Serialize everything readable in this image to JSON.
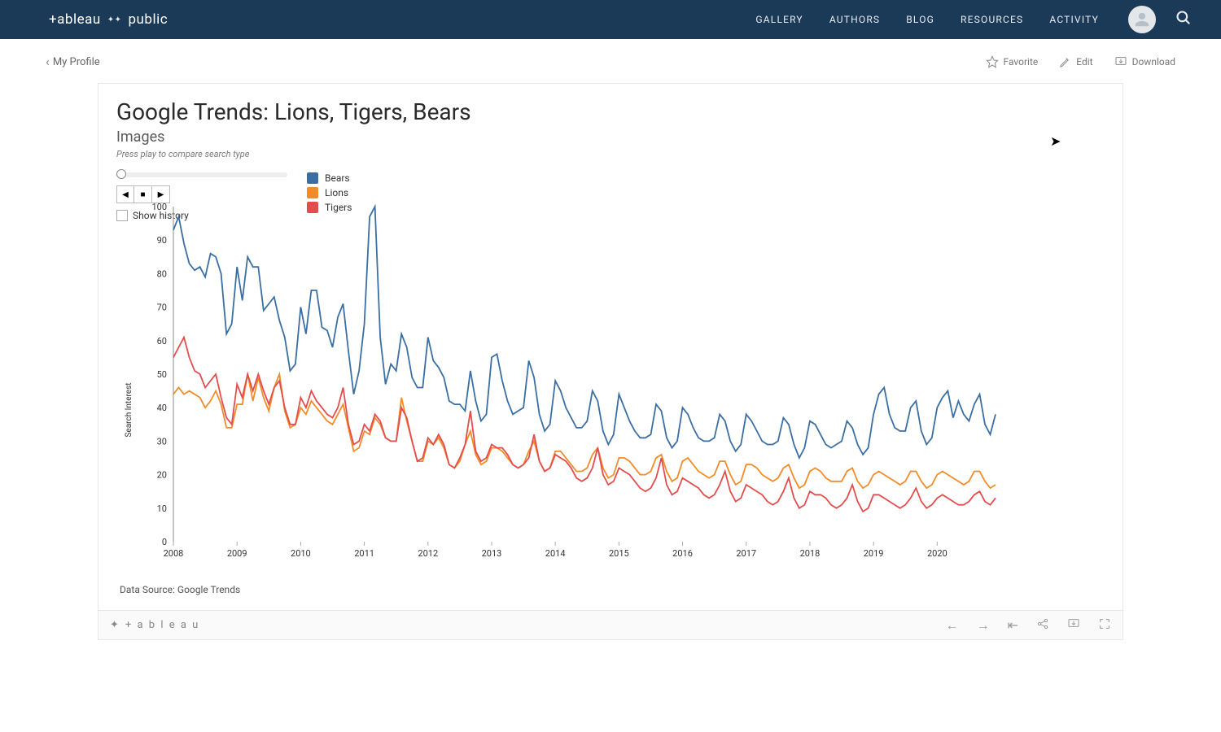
{
  "nav": {
    "brand_left": "+ableau",
    "brand_plus": "✦✦",
    "brand_right": "public",
    "links": [
      "GALLERY",
      "AUTHORS",
      "BLOG",
      "RESOURCES",
      "ACTIVITY"
    ]
  },
  "subbar": {
    "back": "My Profile",
    "favorite": "Favorite",
    "edit": "Edit",
    "download": "Download"
  },
  "viz": {
    "title": "Google Trends: Lions, Tigers, Bears",
    "subtitle": "Images",
    "hint": "Press play to compare search type",
    "show_history": "Show history",
    "data_source": "Data Source: Google Trends"
  },
  "legend": [
    {
      "name": "Bears",
      "color": "#3b6fa3"
    },
    {
      "name": "Lions",
      "color": "#f28c28"
    },
    {
      "name": "Tigers",
      "color": "#e34d4d"
    }
  ],
  "footer": {
    "brand": "+ a b l e a u"
  },
  "chart_data": {
    "type": "line",
    "title": "Google Trends: Lions, Tigers, Bears — Images",
    "xlabel": "",
    "ylabel": "Search Interest",
    "ylim": [
      0,
      100
    ],
    "x_ticks": [
      "2008",
      "2009",
      "2010",
      "2011",
      "2012",
      "2013",
      "2014",
      "2015",
      "2016",
      "2017",
      "2018",
      "2019",
      "2020"
    ],
    "x_step_months": 1,
    "x_start_year": 2008,
    "legend_position": "top-left-inside",
    "series": [
      {
        "name": "Bears",
        "color": "#3b6fa3",
        "values": [
          93,
          97,
          89,
          83,
          81,
          82,
          79,
          86,
          85,
          80,
          62,
          65,
          82,
          72,
          85,
          82,
          82,
          69,
          71,
          73,
          66,
          61,
          51,
          53,
          70,
          62,
          75,
          75,
          64,
          63,
          58,
          67,
          71,
          57,
          44,
          51,
          65,
          97,
          100,
          61,
          47,
          53,
          51,
          62,
          58,
          49,
          46,
          46,
          61,
          54,
          52,
          49,
          42,
          41,
          41,
          39,
          51,
          42,
          36,
          38,
          55,
          56,
          48,
          42,
          38,
          39,
          40,
          54,
          49,
          38,
          33,
          35,
          48,
          45,
          40,
          37,
          34,
          34,
          36,
          45,
          42,
          33,
          29,
          32,
          44,
          40,
          36,
          33,
          31,
          31,
          32,
          41,
          39,
          31,
          28,
          30,
          40,
          38,
          34,
          31,
          30,
          30,
          31,
          38,
          36,
          30,
          27,
          29,
          38,
          36,
          33,
          30,
          29,
          29,
          30,
          37,
          35,
          29,
          25,
          28,
          36,
          35,
          32,
          29,
          28,
          29,
          30,
          36,
          34,
          29,
          26,
          28,
          38,
          44,
          46,
          38,
          34,
          33,
          33,
          40,
          42,
          33,
          29,
          31,
          40,
          43,
          45,
          37,
          42,
          38,
          36,
          41,
          44,
          35,
          32,
          38
        ]
      },
      {
        "name": "Lions",
        "color": "#f28c28",
        "values": [
          44,
          46,
          44,
          45,
          44,
          43,
          40,
          42,
          45,
          41,
          34,
          34,
          41,
          41,
          50,
          42,
          49,
          43,
          39,
          46,
          50,
          39,
          34,
          35,
          40,
          38,
          42,
          40,
          38,
          36,
          35,
          38,
          41,
          34,
          27,
          28,
          33,
          32,
          37,
          35,
          31,
          30,
          30,
          43,
          36,
          30,
          24,
          24,
          30,
          29,
          31,
          28,
          23,
          22,
          24,
          29,
          33,
          26,
          23,
          24,
          28,
          28,
          27,
          25,
          23,
          22,
          23,
          27,
          30,
          24,
          21,
          22,
          27,
          27,
          25,
          23,
          21,
          21,
          22,
          26,
          28,
          22,
          19,
          20,
          25,
          25,
          24,
          22,
          20,
          20,
          21,
          25,
          26,
          21,
          18,
          19,
          24,
          25,
          23,
          21,
          20,
          19,
          20,
          24,
          24,
          20,
          17,
          18,
          23,
          23,
          22,
          20,
          19,
          18,
          19,
          22,
          23,
          19,
          16,
          17,
          21,
          22,
          21,
          19,
          18,
          18,
          18,
          21,
          22,
          18,
          16,
          17,
          20,
          21,
          20,
          19,
          18,
          17,
          18,
          21,
          21,
          18,
          16,
          17,
          20,
          21,
          20,
          19,
          18,
          17,
          18,
          21,
          21,
          18,
          16,
          17
        ]
      },
      {
        "name": "Tigers",
        "color": "#e34d4d",
        "values": [
          55,
          58,
          61,
          55,
          51,
          50,
          46,
          48,
          50,
          43,
          37,
          35,
          47,
          43,
          50,
          45,
          50,
          45,
          41,
          46,
          48,
          40,
          35,
          35,
          43,
          40,
          45,
          42,
          40,
          38,
          37,
          40,
          46,
          35,
          29,
          30,
          35,
          33,
          38,
          36,
          31,
          30,
          30,
          40,
          37,
          30,
          24,
          25,
          31,
          29,
          32,
          29,
          23,
          22,
          25,
          29,
          39,
          27,
          24,
          25,
          29,
          28,
          28,
          26,
          23,
          22,
          23,
          25,
          32,
          24,
          21,
          22,
          26,
          25,
          24,
          22,
          19,
          18,
          19,
          22,
          28,
          20,
          17,
          18,
          22,
          21,
          20,
          18,
          16,
          15,
          16,
          19,
          25,
          17,
          14,
          15,
          19,
          18,
          17,
          16,
          14,
          13,
          14,
          17,
          21,
          15,
          12,
          13,
          17,
          16,
          15,
          14,
          12,
          11,
          12,
          15,
          19,
          13,
          10,
          11,
          15,
          14,
          14,
          13,
          11,
          10,
          11,
          13,
          17,
          12,
          9,
          10,
          14,
          14,
          13,
          12,
          11,
          10,
          11,
          13,
          16,
          12,
          10,
          11,
          13,
          14,
          13,
          12,
          11,
          11,
          12,
          14,
          15,
          12,
          11,
          13
        ]
      }
    ]
  }
}
